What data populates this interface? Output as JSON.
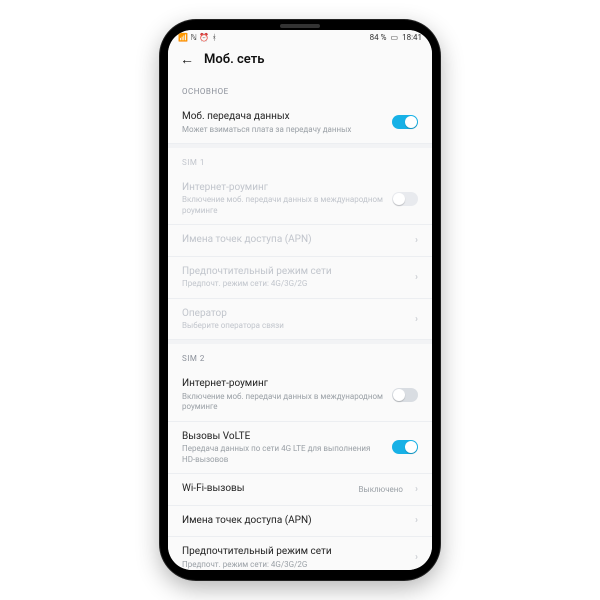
{
  "status": {
    "signal": "📶",
    "nfc": "ℕ",
    "alarm": "⏰",
    "bt": "ᚼ",
    "battery_text": "84 %",
    "battery_icon": "▭",
    "time": "18:41"
  },
  "header": {
    "back": "←",
    "title": "Моб. сеть"
  },
  "sections": {
    "main_label": "ОСНОВНОЕ",
    "mobile_data": {
      "title": "Моб. передача данных",
      "sub": "Может взиматься плата за передачу данных",
      "on": true
    },
    "sim1_label": "SIM 1",
    "sim1_roaming": {
      "title": "Интернет-роуминг",
      "sub": "Включение моб. передачи данных в международном роуминге",
      "on": false
    },
    "sim1_apn": {
      "title": "Имена точек доступа (APN)"
    },
    "sim1_mode": {
      "title": "Предпочтительный режим сети",
      "sub": "Предпочт. режим сети: 4G/3G/2G"
    },
    "sim1_operator": {
      "title": "Оператор",
      "sub": "Выберите оператора связи"
    },
    "sim2_label": "SIM 2",
    "sim2_roaming": {
      "title": "Интернет-роуминг",
      "sub": "Включение моб. передачи данных в международном роуминге",
      "on": false
    },
    "sim2_volte": {
      "title": "Вызовы VoLTE",
      "sub": "Передача данных по сети 4G LTE для выполнения HD-вызовов",
      "on": true
    },
    "sim2_wifi": {
      "title": "Wi-Fi-вызовы",
      "value": "Выключено"
    },
    "sim2_apn": {
      "title": "Имена точек доступа (APN)"
    },
    "sim2_mode": {
      "title": "Предпочтительный режим сети",
      "sub": "Предпочт. режим сети: 4G/3G/2G"
    }
  },
  "colors": {
    "accent": "#17b1e6"
  }
}
